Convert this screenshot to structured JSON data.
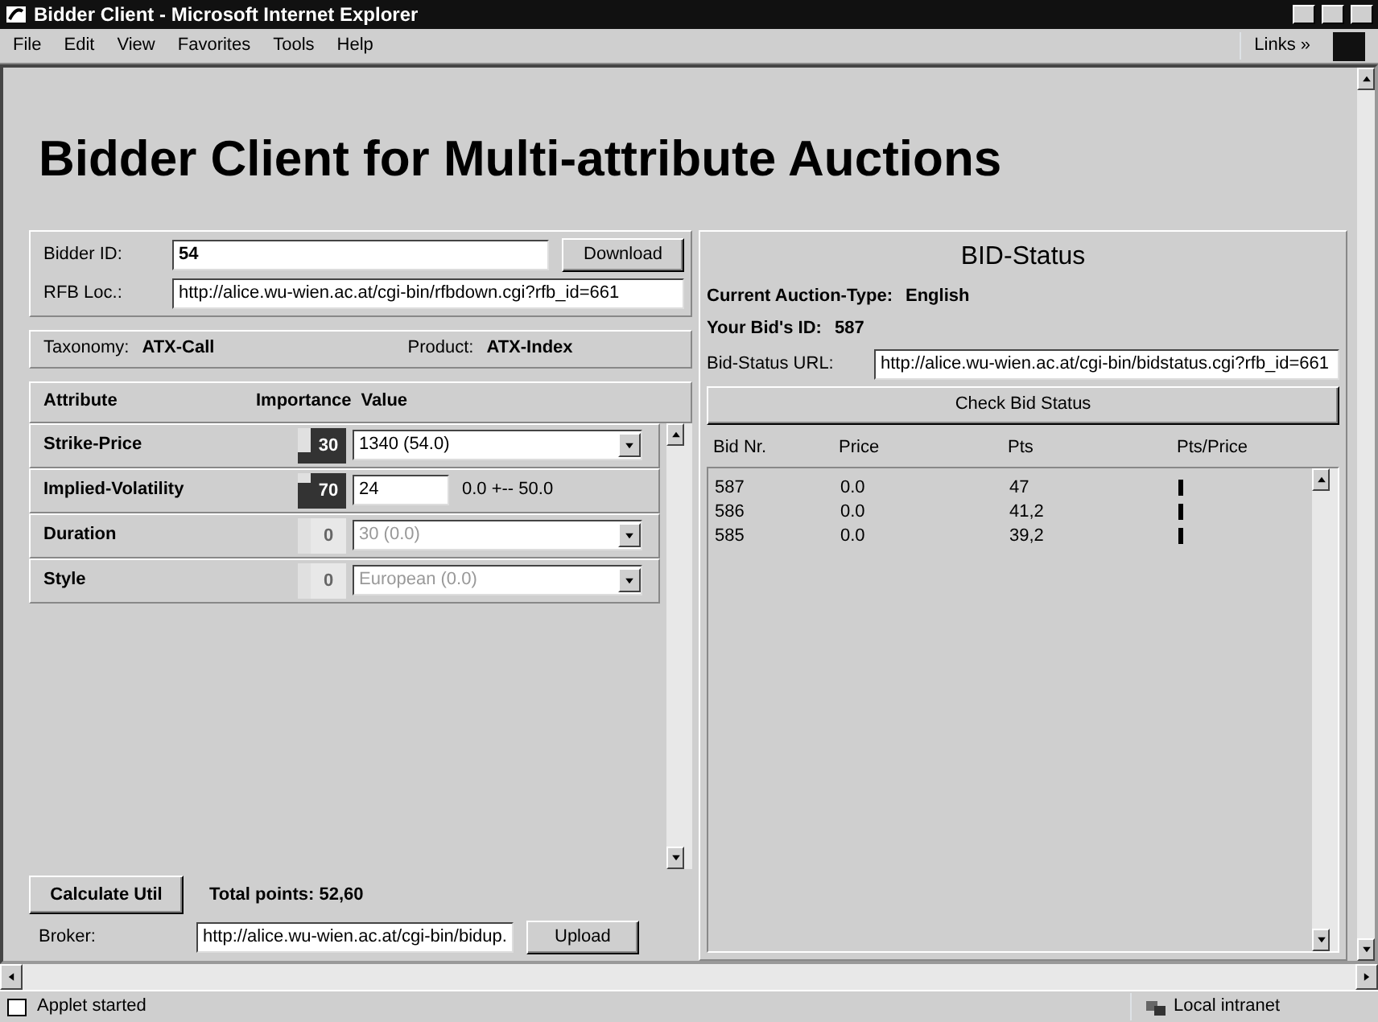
{
  "window": {
    "title": "Bidder Client - Microsoft Internet Explorer"
  },
  "menu": [
    "File",
    "Edit",
    "View",
    "Favorites",
    "Tools",
    "Help"
  ],
  "links": {
    "label": "Links",
    "chevron": "»"
  },
  "heading": "Bidder Client for Multi-attribute Auctions",
  "bidder": {
    "id_label": "Bidder ID:",
    "id_value": "54",
    "download": "Download",
    "rfb_label": "RFB Loc.:",
    "rfb_value": "http://alice.wu-wien.ac.at/cgi-bin/rfbdown.cgi?rfb_id=661"
  },
  "taxonomy": {
    "label": "Taxonomy:",
    "value": "ATX-Call"
  },
  "product": {
    "label": "Product:",
    "value": "ATX-Index"
  },
  "columns": [
    "Attribute",
    "Importance",
    "Value"
  ],
  "attributes": [
    {
      "name": "Strike-Price",
      "importance": "30",
      "level": 0.3,
      "kind": "select",
      "value": "1340 (54.0)",
      "disabled": false
    },
    {
      "name": "Implied-Volatility",
      "importance": "70",
      "level": 0.7,
      "kind": "number",
      "value": "24",
      "range": "0.0 +-- 50.0",
      "disabled": false
    },
    {
      "name": "Duration",
      "importance": "0",
      "kind": "select",
      "value": "30 (0.0)",
      "disabled": true
    },
    {
      "name": "Style",
      "importance": "0",
      "kind": "select",
      "value": "European (0.0)",
      "disabled": true
    }
  ],
  "calculate": "Calculate Util",
  "total": "Total points: 52,60",
  "broker": {
    "label": "Broker:",
    "value": "http://alice.wu-wien.ac.at/cgi-bin/bidup.",
    "upload": "Upload"
  },
  "bid_status": {
    "title": "BID-Status",
    "auction_type": {
      "label": "Current Auction-Type:",
      "value": "English"
    },
    "bid_id": {
      "label": "Your Bid's ID:",
      "value": "587"
    },
    "url": {
      "label": "Bid-Status URL:",
      "value": "http://alice.wu-wien.ac.at/cgi-bin/bidstatus.cgi?rfb_id=661"
    },
    "check": "Check Bid Status",
    "columns": [
      "Bid Nr.",
      "Price",
      "Pts",
      "Pts/Price"
    ],
    "rows": [
      {
        "bid_nr": "587",
        "price": "0.0",
        "pts": "47"
      },
      {
        "bid_nr": "586",
        "price": "0.0",
        "pts": "41,2"
      },
      {
        "bid_nr": "585",
        "price": "0.0",
        "pts": "39,2"
      }
    ]
  },
  "status_bar": {
    "text": "Applet started",
    "zone": "Local intranet"
  }
}
